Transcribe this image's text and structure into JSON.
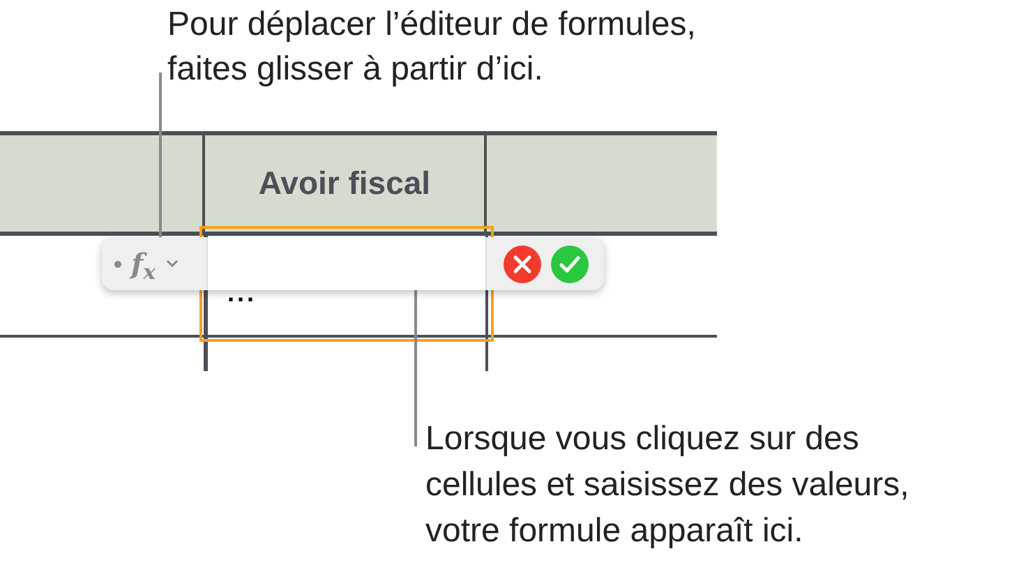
{
  "callouts": [
    {
      "lines": [
        "Pour déplacer l’éditeur de formules,",
        "faites glisser à partir d’ici."
      ]
    },
    {
      "lines": [
        "Lorsque vous cliquez sur des",
        "cellules et saisissez des valeurs,",
        "votre formule apparaît ici."
      ]
    }
  ],
  "table": {
    "header": "Avoir fiscal",
    "cell": "..."
  },
  "formula_editor": {
    "function_label": "f$_{x}$"
  }
}
